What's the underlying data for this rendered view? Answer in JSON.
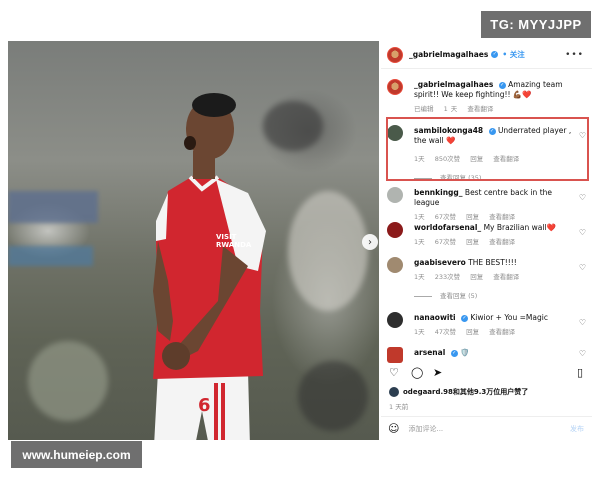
{
  "watermarks": {
    "top": "TG: MYYJJPP",
    "bottom": "www.humeiep.com"
  },
  "post": {
    "author": "_gabrielmagalhaes",
    "follow_label": "• 关注",
    "caption_user": "_gabrielmagalhaes",
    "caption_text": "Amazing team spirit!! We keep fighting!! 💪🏾❤️",
    "caption_meta": [
      "已编辑",
      "1 天",
      "查看翻译"
    ],
    "shirt_text": [
      "VISIT",
      "RWANDA"
    ],
    "shirt_number": "6"
  },
  "comments": [
    {
      "user": "sambilokonga48",
      "verified": true,
      "text": "Underrated player , the wall ❤️",
      "meta": [
        "1天",
        "850次赞",
        "回复",
        "查看翻译"
      ],
      "replies": "查看回复 (35)"
    },
    {
      "user": "bennkingg_",
      "verified": false,
      "text": "Best centre back in the league",
      "meta": [
        "1天",
        "67次赞",
        "回复",
        "查看翻译"
      ],
      "replies": ""
    },
    {
      "user": "worldofarsenal_",
      "verified": false,
      "text": "My Brazilian wall❤️",
      "meta": [
        "1天",
        "67次赞",
        "回复",
        "查看翻译"
      ],
      "replies": ""
    },
    {
      "user": "gaabisevero",
      "verified": false,
      "text": "THE BEST!!!!",
      "meta": [
        "1天",
        "233次赞",
        "回复",
        "查看翻译"
      ],
      "replies": "查看回复 (5)"
    },
    {
      "user": "nanaowiti",
      "verified": true,
      "text": "Kiwior + You =Magic",
      "meta": [
        "1天",
        "47次赞",
        "回复",
        "查看翻译"
      ],
      "replies": ""
    },
    {
      "user": "arsenal",
      "verified": true,
      "text": "🛡️",
      "meta": [],
      "replies": ""
    }
  ],
  "likes_text": "odegaard.98和其他9.3万位用户赞了",
  "date_text": "1 天前",
  "compose": {
    "placeholder": "添加评论...",
    "post_label": "发布"
  },
  "colors": {
    "accent": "#3897f0",
    "highlight": "#d9534f",
    "shirt_red": "#d1262f"
  }
}
